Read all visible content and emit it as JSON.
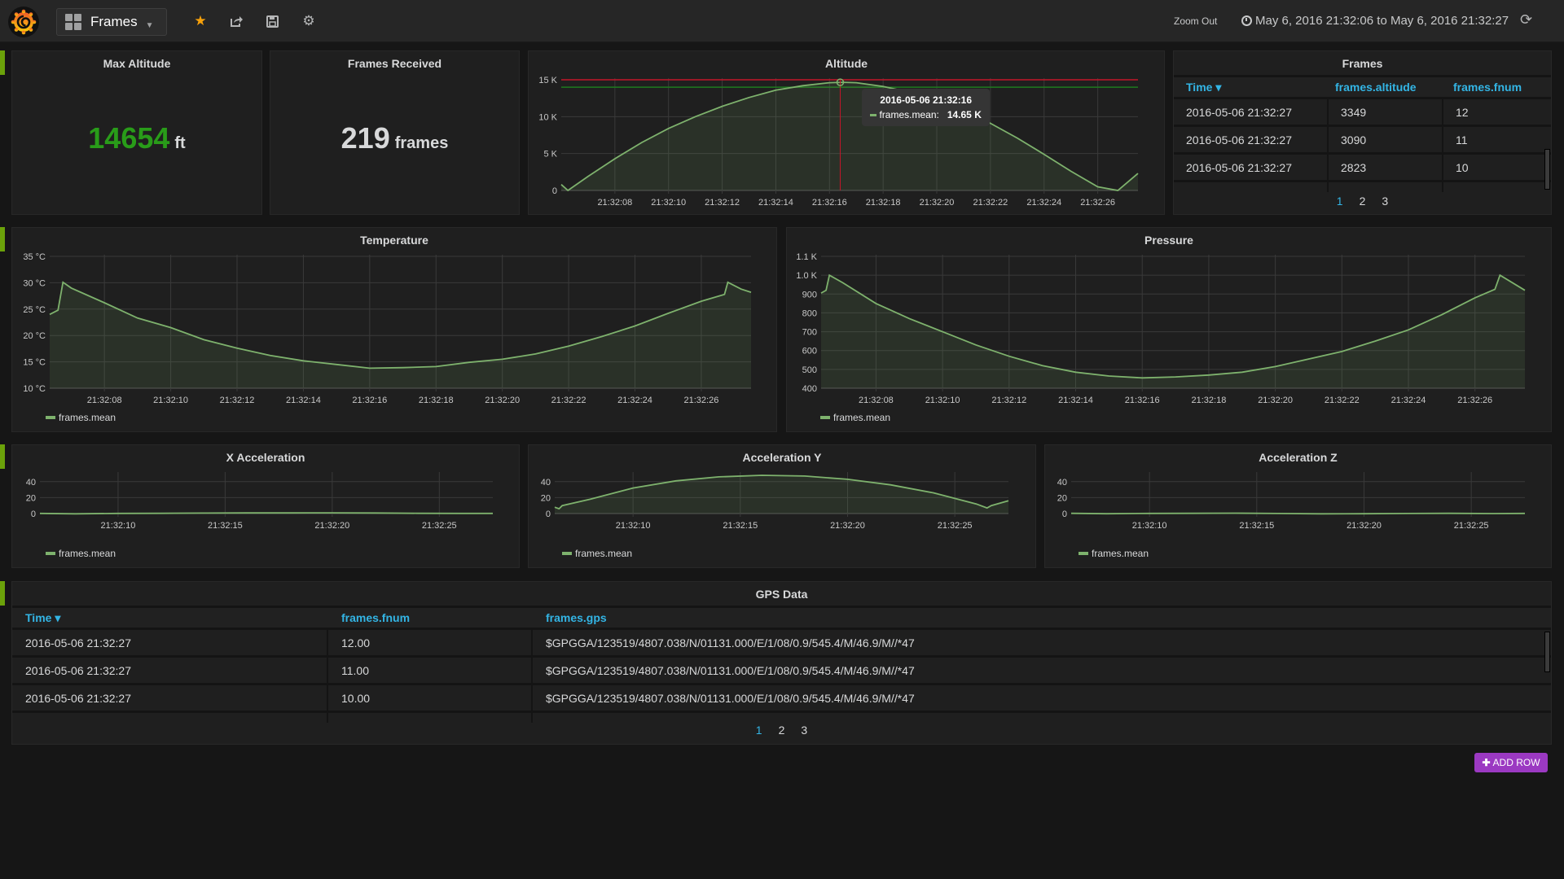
{
  "topbar": {
    "dashboard_title": "Frames",
    "zoom_out_label": "Zoom Out",
    "time_range": "May 6, 2016 21:32:06 to May 6, 2016 21:32:27",
    "icons": [
      "grafana-logo-icon",
      "dashboard-grid-icon",
      "star-icon",
      "share-icon",
      "save-icon",
      "gear-icon",
      "clock-icon",
      "refresh-icon"
    ],
    "star_color": "#f7a10a"
  },
  "stats": {
    "max_altitude": {
      "title": "Max Altitude",
      "value": "14654",
      "unit": "ft",
      "color": "#299c19"
    },
    "frames_received": {
      "title": "Frames Received",
      "value": "219",
      "unit": "frames",
      "color": "#d8d9da"
    }
  },
  "frames_table": {
    "title": "Frames",
    "columns": [
      "Time",
      "frames.altitude",
      "frames.fnum"
    ],
    "rows": [
      [
        "2016-05-06 21:32:27",
        "3349",
        "12"
      ],
      [
        "2016-05-06 21:32:27",
        "3090",
        "11"
      ],
      [
        "2016-05-06 21:32:27",
        "2823",
        "10"
      ]
    ],
    "pages": [
      "1",
      "2",
      "3"
    ],
    "active_page": "1"
  },
  "gps_table": {
    "title": "GPS Data",
    "columns": [
      "Time",
      "frames.fnum",
      "frames.gps"
    ],
    "rows": [
      [
        "2016-05-06 21:32:27",
        "12.00",
        "$GPGGA/123519/4807.038/N/01131.000/E/1/08/0.9/545.4/M/46.9/M//*47"
      ],
      [
        "2016-05-06 21:32:27",
        "11.00",
        "$GPGGA/123519/4807.038/N/01131.000/E/1/08/0.9/545.4/M/46.9/M//*47"
      ],
      [
        "2016-05-06 21:32:27",
        "10.00",
        "$GPGGA/123519/4807.038/N/01131.000/E/1/08/0.9/545.4/M/46.9/M//*47"
      ]
    ],
    "pages": [
      "1",
      "2",
      "3"
    ],
    "active_page": "1"
  },
  "add_row_label": "ADD ROW",
  "series_color": "#7eb26d",
  "chart_data": [
    {
      "id": "altitude",
      "type": "area",
      "title": "Altitude",
      "series_name": "frames.mean",
      "x_range": [
        6.0,
        27.5
      ],
      "x_ticks": [
        8,
        10,
        12,
        14,
        16,
        18,
        20,
        22,
        24,
        26
      ],
      "x_tick_labels": [
        "21:32:08",
        "21:32:10",
        "21:32:12",
        "21:32:14",
        "21:32:16",
        "21:32:18",
        "21:32:20",
        "21:32:22",
        "21:32:24",
        "21:32:26"
      ],
      "y_range": [
        0,
        15000
      ],
      "y_ticks": [
        0,
        5000,
        10000,
        15000
      ],
      "y_tick_labels": [
        "0",
        "5 K",
        "10 K",
        "15 K"
      ],
      "x": [
        6.0,
        6.25,
        7,
        8,
        9,
        10,
        11,
        12,
        13,
        14,
        15,
        16,
        16.5,
        17,
        18,
        19,
        20,
        21,
        22,
        23,
        24,
        25,
        26,
        26.75,
        27.5
      ],
      "y": [
        800,
        0,
        1900,
        4300,
        6500,
        8400,
        10000,
        11400,
        12600,
        13600,
        14200,
        14600,
        14654,
        14600,
        14100,
        13300,
        12200,
        10800,
        9100,
        7100,
        4900,
        2600,
        500,
        0,
        2300
      ],
      "thresholds": [
        {
          "value": 15000,
          "color": "#c4162a"
        },
        {
          "value": 14000,
          "color": "#1f7a1f"
        }
      ],
      "crosshair_x": 16.4,
      "tooltip": {
        "time": "2016-05-06 21:32:16",
        "series": "frames.mean:",
        "value": "14.65 K"
      },
      "legend": false
    },
    {
      "id": "temperature",
      "type": "area",
      "title": "Temperature",
      "series_name": "frames.mean",
      "x_range": [
        6.35,
        27.5
      ],
      "x_ticks": [
        8,
        10,
        12,
        14,
        16,
        18,
        20,
        22,
        24,
        26
      ],
      "x_tick_labels": [
        "21:32:08",
        "21:32:10",
        "21:32:12",
        "21:32:14",
        "21:32:16",
        "21:32:18",
        "21:32:20",
        "21:32:22",
        "21:32:24",
        "21:32:26"
      ],
      "y_range": [
        10,
        35
      ],
      "y_ticks": [
        10,
        15,
        20,
        25,
        30,
        35
      ],
      "y_tick_labels": [
        "10 °C",
        "15 °C",
        "20 °C",
        "25 °C",
        "30 °C",
        "35 °C"
      ],
      "x": [
        6.35,
        6.6,
        6.75,
        7,
        8,
        9,
        10,
        11,
        12,
        13,
        14,
        15,
        16,
        17,
        18,
        19,
        20,
        21,
        22,
        23,
        24,
        25,
        26,
        26.7,
        26.8,
        27.2,
        27.5
      ],
      "y": [
        24,
        24.8,
        30.1,
        29,
        26.2,
        23.3,
        21.5,
        19.2,
        17.6,
        16.2,
        15.2,
        14.5,
        13.8,
        13.9,
        14.1,
        14.9,
        15.5,
        16.5,
        18,
        19.8,
        21.8,
        24.2,
        26.5,
        27.8,
        30.1,
        28.8,
        28.2
      ],
      "legend": true
    },
    {
      "id": "pressure",
      "type": "area",
      "title": "Pressure",
      "series_name": "frames.mean",
      "x_range": [
        6.35,
        27.5
      ],
      "x_ticks": [
        8,
        10,
        12,
        14,
        16,
        18,
        20,
        22,
        24,
        26
      ],
      "x_tick_labels": [
        "21:32:08",
        "21:32:10",
        "21:32:12",
        "21:32:14",
        "21:32:16",
        "21:32:18",
        "21:32:20",
        "21:32:22",
        "21:32:24",
        "21:32:26"
      ],
      "y_range": [
        400,
        1100
      ],
      "y_ticks": [
        400,
        500,
        600,
        700,
        800,
        900,
        1000,
        1100
      ],
      "y_tick_labels": [
        "400",
        "500",
        "600",
        "700",
        "800",
        "900",
        "1.0 K",
        "1.1 K"
      ],
      "x": [
        6.35,
        6.5,
        6.6,
        7,
        8,
        9,
        10,
        11,
        12,
        13,
        14,
        15,
        16,
        17,
        18,
        19,
        20,
        21,
        22,
        23,
        24,
        25,
        26,
        26.6,
        26.75,
        27.5
      ],
      "y": [
        905,
        920,
        1000,
        960,
        850,
        770,
        700,
        630,
        570,
        520,
        485,
        465,
        455,
        460,
        470,
        485,
        515,
        555,
        595,
        650,
        710,
        790,
        880,
        925,
        1000,
        920
      ],
      "legend": true
    },
    {
      "id": "accel_x",
      "type": "line",
      "title": "X Acceleration",
      "series_name": "frames.mean",
      "x_range": [
        6.35,
        27.5
      ],
      "x_ticks": [
        10,
        15,
        20,
        25
      ],
      "x_tick_labels": [
        "21:32:10",
        "21:32:15",
        "21:32:20",
        "21:32:25"
      ],
      "y_range": [
        0,
        50
      ],
      "y_ticks": [
        0,
        20,
        40
      ],
      "y_tick_labels": [
        "0",
        "20",
        "40"
      ],
      "x": [
        6.35,
        8,
        10,
        12,
        14,
        16,
        18,
        20,
        22,
        24,
        26,
        27.5
      ],
      "y": [
        0.2,
        -0.3,
        0.2,
        0.3,
        0.6,
        0.8,
        0.8,
        0.9,
        0.7,
        0.3,
        0.2,
        0.2
      ],
      "legend": true
    },
    {
      "id": "accel_y",
      "type": "area",
      "title": "Acceleration Y",
      "series_name": "frames.mean",
      "x_range": [
        6.35,
        27.5
      ],
      "x_ticks": [
        10,
        15,
        20,
        25
      ],
      "x_tick_labels": [
        "21:32:10",
        "21:32:15",
        "21:32:20",
        "21:32:25"
      ],
      "y_range": [
        0,
        50
      ],
      "y_ticks": [
        0,
        20,
        40
      ],
      "y_tick_labels": [
        "0",
        "20",
        "40"
      ],
      "x": [
        6.35,
        6.55,
        6.7,
        8,
        10,
        12,
        14,
        16,
        18,
        20,
        22,
        24,
        26,
        26.5,
        26.7,
        27.5
      ],
      "y": [
        8,
        6,
        10,
        18,
        32,
        41,
        46,
        48,
        47,
        43,
        36,
        26,
        12,
        7,
        10,
        16
      ],
      "legend": true
    },
    {
      "id": "accel_z",
      "type": "line",
      "title": "Acceleration Z",
      "series_name": "frames.mean",
      "x_range": [
        6.35,
        27.5
      ],
      "x_ticks": [
        10,
        15,
        20,
        25
      ],
      "x_tick_labels": [
        "21:32:10",
        "21:32:15",
        "21:32:20",
        "21:32:25"
      ],
      "y_range": [
        0,
        50
      ],
      "y_ticks": [
        0,
        20,
        40
      ],
      "y_tick_labels": [
        "0",
        "20",
        "40"
      ],
      "x": [
        6.35,
        8,
        10,
        12,
        14,
        16,
        18,
        20,
        22,
        24,
        26,
        27.5
      ],
      "y": [
        0.3,
        -0.2,
        0.2,
        0.3,
        0.5,
        0.1,
        -0.3,
        -0.2,
        0.1,
        0.3,
        0,
        0.2
      ],
      "legend": true
    }
  ]
}
